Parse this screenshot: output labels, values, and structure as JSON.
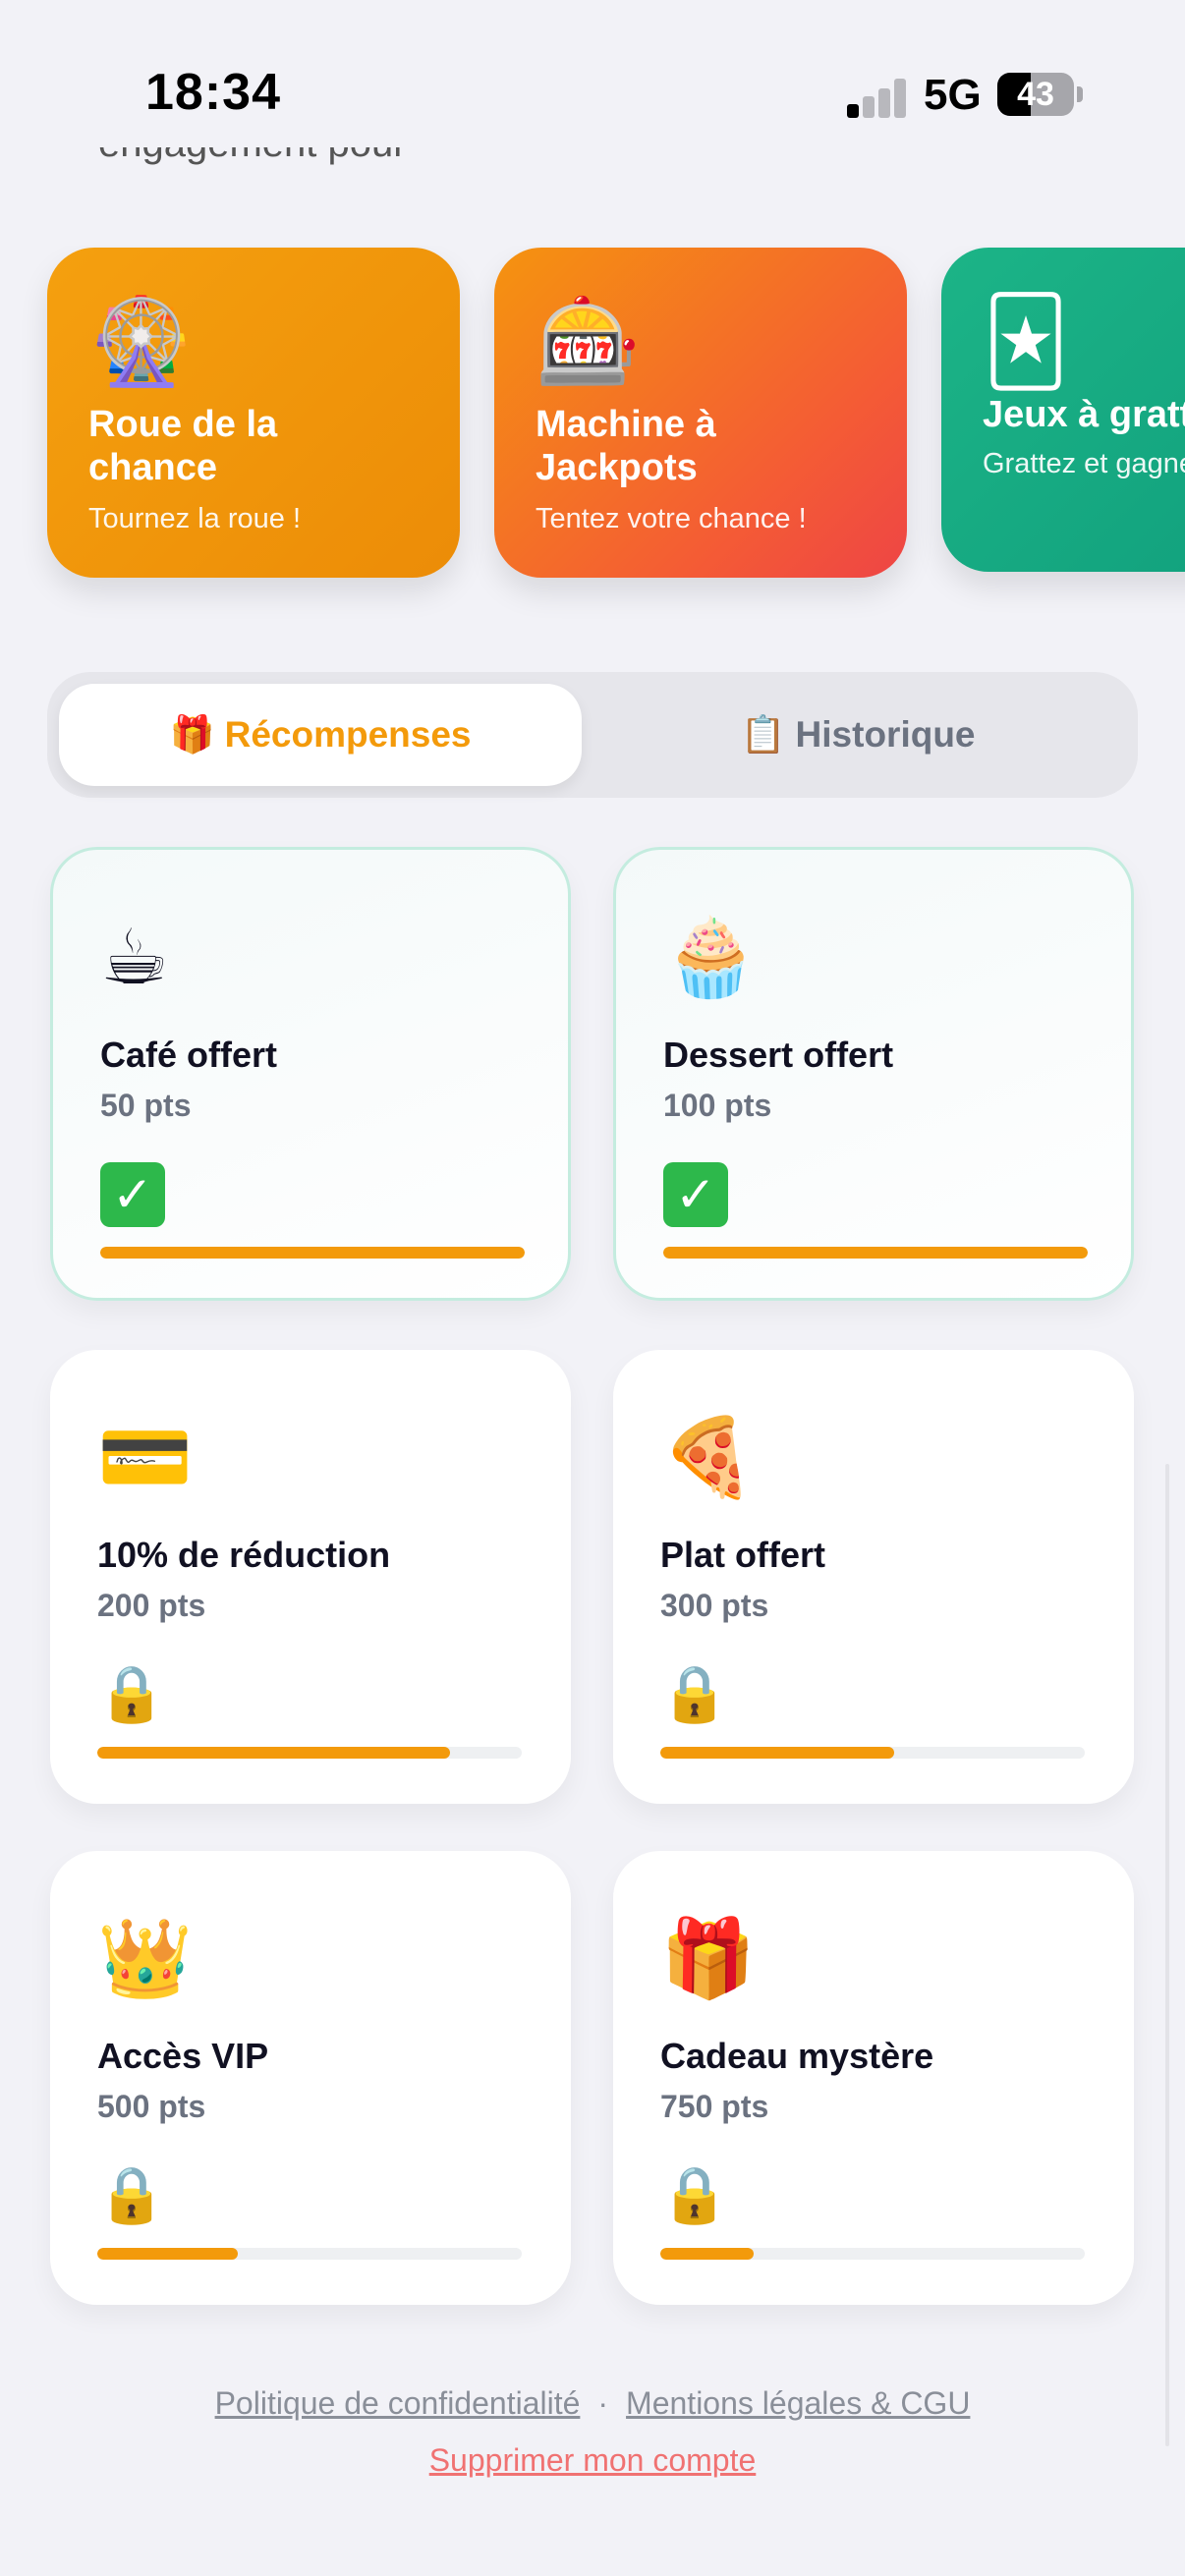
{
  "status_bar": {
    "time": "18:34",
    "network": "5G",
    "battery": "43",
    "battery_level": 0.43
  },
  "scrolled_text": "engagement pour",
  "games": [
    {
      "icon": "ferris-wheel-icon",
      "glyph": "🎡",
      "title": "Roue de la chance",
      "subtitle": "Tournez la roue !",
      "color": "#f39a0b"
    },
    {
      "icon": "slot-machine-icon",
      "glyph": "🎰",
      "title": "Machine à Jackpots",
      "subtitle": "Tentez votre chance !",
      "color": "#f4593a"
    },
    {
      "icon": "joker-card-icon",
      "glyph": "🃏",
      "title": "Jeux à gratter",
      "subtitle": "Grattez et gagnez",
      "color": "#16a985"
    }
  ],
  "tabs": [
    {
      "icon": "gift-icon",
      "glyph": "🎁",
      "label": "Récompenses",
      "active": true
    },
    {
      "icon": "clipboard-icon",
      "glyph": "📋",
      "label": "Historique",
      "active": false
    }
  ],
  "rewards": [
    {
      "icon": "coffee-icon",
      "glyph": "☕",
      "title": "Café offert",
      "points": "50 pts",
      "status": "unlocked",
      "status_glyph": "✓",
      "progress": 1.0
    },
    {
      "icon": "cupcake-icon",
      "glyph": "🧁",
      "title": "Dessert offert",
      "points": "100 pts",
      "status": "unlocked",
      "status_glyph": "✓",
      "progress": 1.0
    },
    {
      "icon": "credit-card-icon",
      "glyph": "💳",
      "title": "10% de réduction",
      "points": "200 pts",
      "status": "locked",
      "status_glyph": "🔒",
      "progress": 0.83
    },
    {
      "icon": "pizza-icon",
      "glyph": "🍕",
      "title": "Plat offert",
      "points": "300 pts",
      "status": "locked",
      "status_glyph": "🔒",
      "progress": 0.55
    },
    {
      "icon": "crown-icon",
      "glyph": "👑",
      "title": "Accès VIP",
      "points": "500 pts",
      "status": "locked",
      "status_glyph": "🔒",
      "progress": 0.33
    },
    {
      "icon": "wrapped-gift-icon",
      "glyph": "🎁",
      "title": "Cadeau mystère",
      "points": "750 pts",
      "status": "locked",
      "status_glyph": "🔒",
      "progress": 0.22
    }
  ],
  "footer": {
    "privacy": "Politique de confidentialité",
    "separator": "·",
    "legal": "Mentions légales & CGU",
    "delete_account": "Supprimer mon compte"
  },
  "colors": {
    "accent": "#f39a0b",
    "success": "#2db84b",
    "danger": "#f07272",
    "muted": "#6b7280"
  }
}
